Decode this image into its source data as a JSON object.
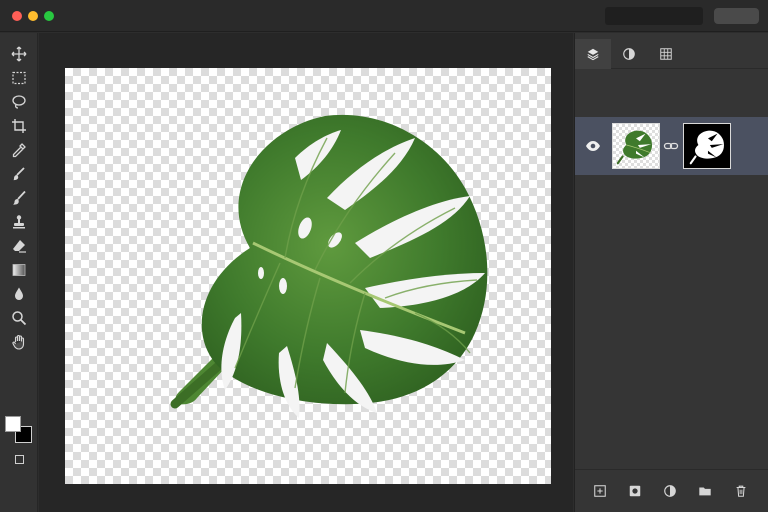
{
  "window": {
    "controls": [
      "close",
      "minimize",
      "zoom"
    ],
    "accent": {
      "close": "#fe5f57",
      "minimize": "#febc2e",
      "zoom": "#28c840"
    }
  },
  "tools": [
    {
      "id": "move",
      "icon": "move-icon"
    },
    {
      "id": "marquee",
      "icon": "rect-marquee-icon"
    },
    {
      "id": "lasso",
      "icon": "lasso-icon"
    },
    {
      "id": "crop",
      "icon": "crop-icon"
    },
    {
      "id": "eyedropper",
      "icon": "eyedropper-icon"
    },
    {
      "id": "healing-brush",
      "icon": "healing-brush-icon"
    },
    {
      "id": "brush",
      "icon": "brush-icon"
    },
    {
      "id": "clone-stamp",
      "icon": "stamp-icon"
    },
    {
      "id": "eraser",
      "icon": "eraser-icon"
    },
    {
      "id": "gradient",
      "icon": "gradient-icon"
    },
    {
      "id": "blur",
      "icon": "drop-icon"
    },
    {
      "id": "zoom",
      "icon": "zoom-icon"
    },
    {
      "id": "hand",
      "icon": "hand-icon"
    }
  ],
  "colors": {
    "foreground": "#ffffff",
    "background": "#000000"
  },
  "panel": {
    "tabs": [
      {
        "id": "layers",
        "icon": "layers-icon",
        "active": true
      },
      {
        "id": "adjustments",
        "icon": "adjustments-icon",
        "active": false
      },
      {
        "id": "grid",
        "icon": "grid-icon",
        "active": false
      }
    ],
    "layer": {
      "visible": true,
      "has_mask": true,
      "linked": true,
      "selected": true
    },
    "footer": [
      "new-layer-icon",
      "mask-icon",
      "adjustment-icon",
      "folder-icon",
      "trash-icon"
    ]
  }
}
